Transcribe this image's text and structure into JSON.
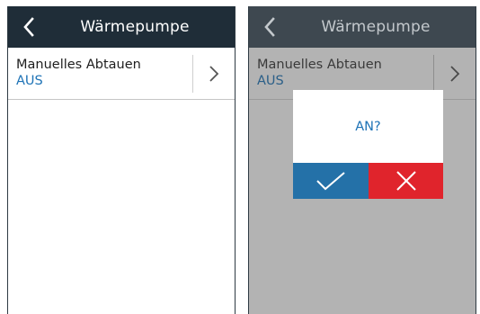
{
  "screens": [
    {
      "header": {
        "title": "Wärmepumpe",
        "back_icon": "chevron-left-icon"
      },
      "setting": {
        "label": "Manuelles Abtauen",
        "value": "AUS",
        "nav_icon": "chevron-right-icon"
      }
    },
    {
      "header": {
        "title": "Wärmepumpe",
        "back_icon": "chevron-left-icon"
      },
      "setting": {
        "label": "Manuelles Abtauen",
        "value": "AUS",
        "nav_icon": "chevron-right-icon"
      },
      "dialog": {
        "message": "AN?",
        "confirm_icon": "checkmark-icon",
        "cancel_icon": "x-icon"
      }
    }
  ],
  "colors": {
    "header_bg": "#1f2d38",
    "header_bg_dimmed": "#3e4850",
    "overlay_bg": "#b3b3b3",
    "accent_blue": "#1e73b6",
    "confirm_blue": "#2471a8",
    "cancel_red": "#e0242c"
  }
}
